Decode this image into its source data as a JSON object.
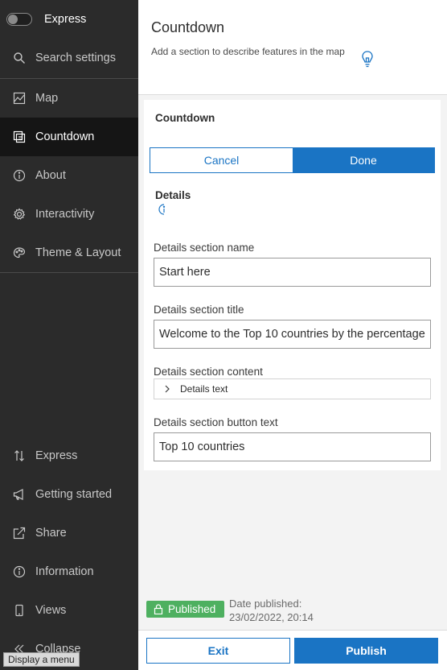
{
  "sidebar": {
    "mode_toggle": {
      "label": "Express",
      "on": false
    },
    "search": {
      "label": "Search settings",
      "icon": "search-icon"
    },
    "items": [
      {
        "label": "Map",
        "icon": "map-icon",
        "active": false
      },
      {
        "label": "Countdown",
        "icon": "countdown-icon",
        "active": true
      },
      {
        "label": "About",
        "icon": "info-icon",
        "active": false
      },
      {
        "label": "Interactivity",
        "icon": "gear-icon",
        "active": false
      },
      {
        "label": "Theme & Layout",
        "icon": "palette-icon",
        "active": false
      }
    ],
    "bottom_items": [
      {
        "label": "Express",
        "icon": "sort-arrows-icon"
      },
      {
        "label": "Getting started",
        "icon": "megaphone-icon"
      },
      {
        "label": "Share",
        "icon": "share-icon"
      },
      {
        "label": "Information",
        "icon": "info-icon"
      },
      {
        "label": "Views",
        "icon": "device-icon"
      },
      {
        "label": "Collapse",
        "icon": "collapse-icon"
      }
    ],
    "tooltip": "Display a menu"
  },
  "header": {
    "title": "Countdown",
    "description": "Add a section to describe features in the map"
  },
  "card": {
    "title": "Countdown",
    "cancel_label": "Cancel",
    "done_label": "Done",
    "section_label": "Details",
    "fields": {
      "name_label": "Details section name",
      "name_value": "Start here",
      "title_label": "Details section title",
      "title_value": "Welcome to the Top 10 countries by the percentage",
      "content_label": "Details section content",
      "content_expander": "Details text",
      "button_label": "Details section button text",
      "button_value": "Top 10 countries"
    }
  },
  "status": {
    "badge": "Published",
    "date_label": "Date published:",
    "date_value": "23/02/2022, 20:14"
  },
  "footer": {
    "exit_label": "Exit",
    "publish_label": "Publish"
  },
  "colors": {
    "accent": "#1a74c4",
    "sidebar_bg": "#2b2b2b",
    "published_green": "#4eb060"
  }
}
